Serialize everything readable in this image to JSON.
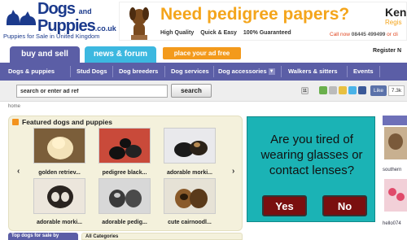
{
  "logo": {
    "brand": "Dogs",
    "and": "and",
    "brand2": "Puppies",
    "tld": ".co.uk",
    "tagline": "Puppies for Sale in United Kingdom"
  },
  "banner": {
    "headline": "Need pedigree papers?",
    "features": [
      "High Quality",
      "Quick & Easy",
      "100% Guaranteed"
    ],
    "call_label": "Call now",
    "call_number": "08445 499499",
    "call_suffix": "or cli",
    "side_brand": "Ken",
    "side_sub": "Regis"
  },
  "tabs": {
    "buy": "buy and sell",
    "news": "news & forum",
    "place_ad": "place your ad free",
    "register": "Register N"
  },
  "nav": {
    "items": [
      "Dogs & puppies",
      "Stud Dogs",
      "Dog breeders",
      "Dog services",
      "Dog accessories",
      "Walkers & sitters",
      "Events"
    ]
  },
  "search": {
    "placeholder": "search or enter ad ref",
    "button": "search",
    "share_count": "11",
    "like": "Like",
    "like_count": "7.3k"
  },
  "breadcrumb": "home",
  "featured": {
    "title": "Featured dogs and puppies",
    "items": [
      {
        "label": "golden retriev..."
      },
      {
        "label": "pedigree black..."
      },
      {
        "label": "adorable morki..."
      },
      {
        "label": "adorable morki..."
      },
      {
        "label": "adorable pedig..."
      },
      {
        "label": "cute cairnoodl..."
      }
    ]
  },
  "ad": {
    "text": "Are you tired of wearing glasses or contact lenses?",
    "yes": "Yes",
    "no": "No"
  },
  "right_sidebar": {
    "label1": "southern",
    "label2": "hello074"
  },
  "bottom": {
    "left": "Top dogs for sale by",
    "mid": "All Categories"
  },
  "colors": {
    "nav_purple": "#5b5ea6",
    "news_blue": "#3cb8e0",
    "orange": "#f39a1c",
    "ad_teal": "#1bb3b5",
    "ad_button": "#7a0f0f"
  }
}
